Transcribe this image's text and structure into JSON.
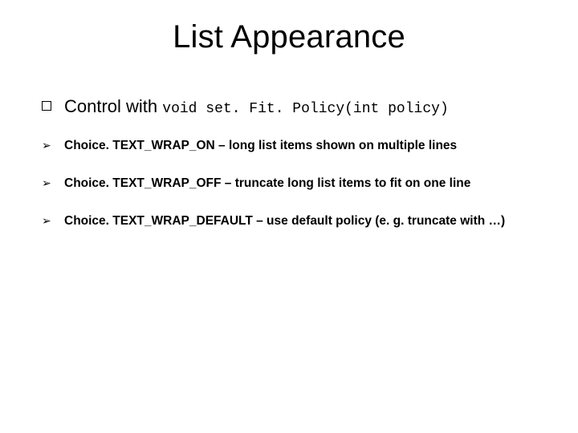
{
  "title": "List Appearance",
  "lead": {
    "prefix": "Control with ",
    "code": "void set. Fit. Policy(int policy)"
  },
  "items": [
    "Choice. TEXT_WRAP_ON – long list items shown on multiple lines",
    "Choice. TEXT_WRAP_OFF – truncate long list items to fit on one line",
    "Choice. TEXT_WRAP_DEFAULT – use default policy (e. g. truncate with …)"
  ],
  "glyphs": {
    "arrow": "➢"
  }
}
